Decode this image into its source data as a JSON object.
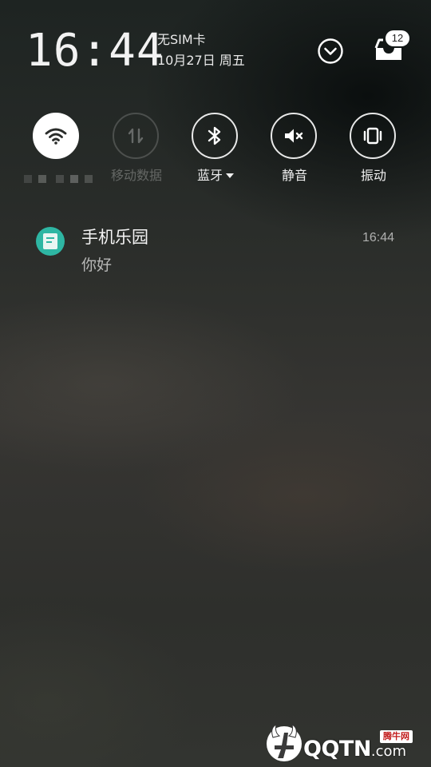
{
  "status_header": {
    "time": "16:44",
    "sim_status": "无SIM卡",
    "date": "10月27日 周五",
    "inbox_count": "12"
  },
  "quick_toggles": [
    {
      "id": "wifi",
      "label": "",
      "state": "on",
      "icon": "wifi-icon"
    },
    {
      "id": "mobile_data",
      "label": "移动数据",
      "state": "disabled",
      "icon": "mobile-data-arrows-icon"
    },
    {
      "id": "bluetooth",
      "label": "蓝牙",
      "state": "off",
      "icon": "bluetooth-icon",
      "has_dropdown": true
    },
    {
      "id": "mute",
      "label": "静音",
      "state": "off",
      "icon": "speaker-mute-icon"
    },
    {
      "id": "vibrate",
      "label": "振动",
      "state": "off",
      "icon": "vibrate-icon"
    }
  ],
  "notification": {
    "app_name": "手机乐园",
    "time": "16:44",
    "message": "你好",
    "icon": "app-document-icon",
    "icon_color": "#2eb6a3"
  },
  "watermark": {
    "brand": "QQTN",
    "domain": ".com",
    "tag": "腾牛网"
  }
}
